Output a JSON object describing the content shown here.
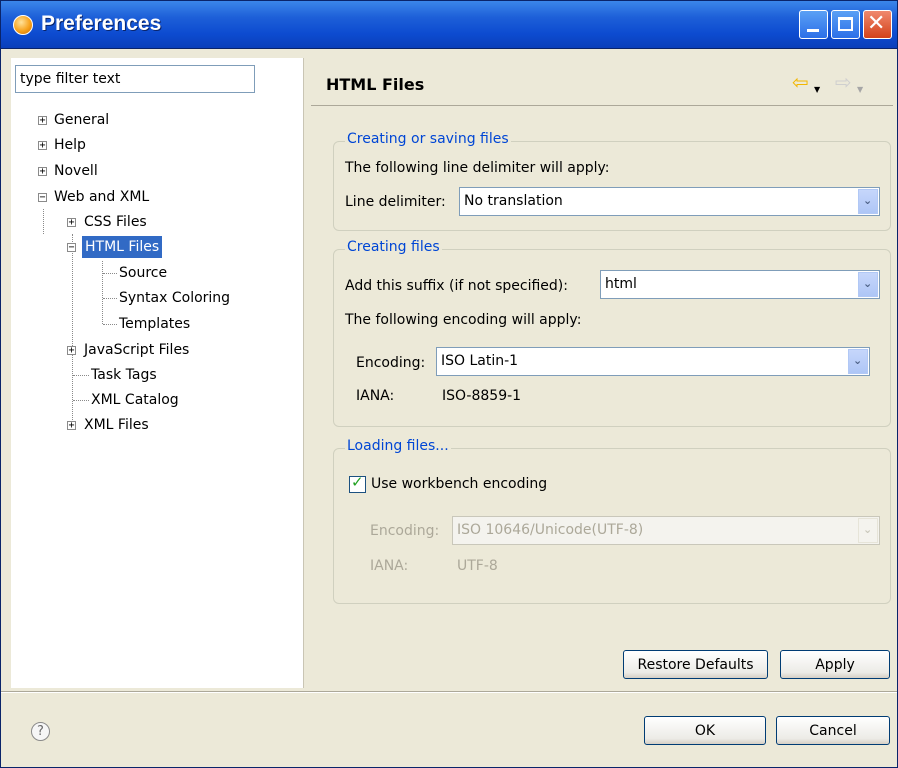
{
  "window": {
    "title": "Preferences"
  },
  "filter": {
    "value": "type filter text"
  },
  "tree": {
    "items": [
      {
        "label": "General",
        "expander": "+"
      },
      {
        "label": "Help",
        "expander": "+"
      },
      {
        "label": "Novell",
        "expander": "+"
      },
      {
        "label": "Web and XML",
        "expander": "−"
      },
      {
        "label": "CSS Files",
        "expander": "+"
      },
      {
        "label": "HTML Files",
        "expander": "−",
        "selected": true
      },
      {
        "label": "Source"
      },
      {
        "label": "Syntax Coloring"
      },
      {
        "label": "Templates"
      },
      {
        "label": "JavaScript Files",
        "expander": "+"
      },
      {
        "label": "Task Tags"
      },
      {
        "label": "XML Catalog"
      },
      {
        "label": "XML Files",
        "expander": "+"
      }
    ]
  },
  "page": {
    "title": "HTML Files"
  },
  "groups": {
    "saving": {
      "title": "Creating or saving files",
      "description": "The following line delimiter will apply:",
      "delimiter_label": "Line delimiter:",
      "delimiter_value": "No translation"
    },
    "creating": {
      "title": "Creating files",
      "suffix_label": "Add this suffix (if not specified):",
      "suffix_value": "html",
      "encoding_description": "The following encoding will apply:",
      "encoding_label": "Encoding:",
      "encoding_value": "ISO Latin-1",
      "iana_label": "IANA:",
      "iana_value": "ISO-8859-1"
    },
    "loading": {
      "title": "Loading files...",
      "workbench_label": "Use workbench encoding",
      "workbench_checked": true,
      "encoding_label": "Encoding:",
      "encoding_value": "ISO 10646/Unicode(UTF-8)",
      "iana_label": "IANA:",
      "iana_value": "UTF-8"
    }
  },
  "buttons": {
    "restore_defaults": "Restore Defaults",
    "apply": "Apply",
    "ok": "OK",
    "cancel": "Cancel"
  },
  "icons": {
    "help": "question-mark-circle",
    "back": "arrow-left",
    "forward": "arrow-right",
    "dropdown": "chevron-down",
    "checkmark": "check"
  },
  "colors": {
    "titlebar": "#0d4bd0",
    "group_title": "#0046d5",
    "selection": "#316ac5",
    "dialog_bg": "#ece9d8"
  }
}
